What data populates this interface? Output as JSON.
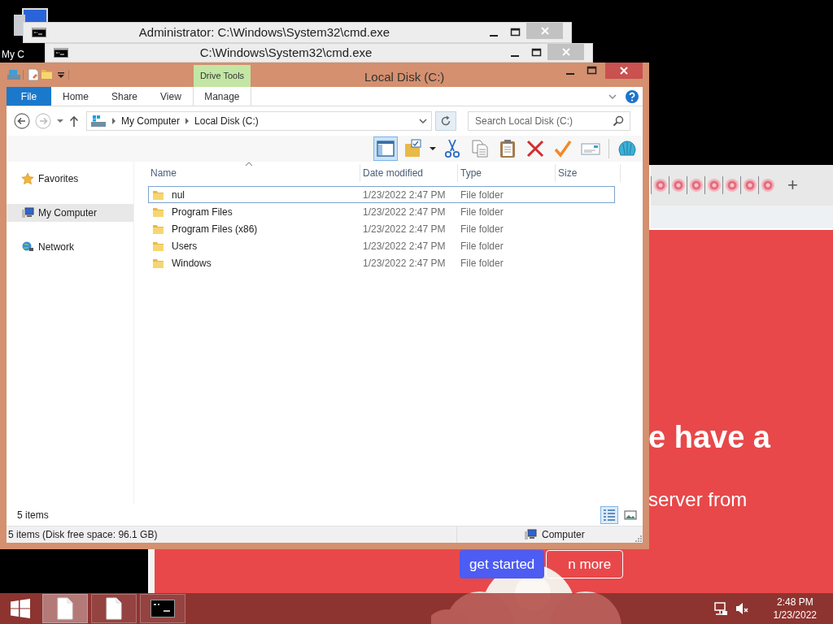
{
  "desktop": {
    "icon_label": "My C"
  },
  "cmd_windows": [
    {
      "title": "Administrator: C:\\Windows\\System32\\cmd.exe"
    },
    {
      "title": "C:\\Windows\\System32\\cmd.exe"
    }
  ],
  "browser": {
    "tabs": [
      {
        "kind": "flower"
      },
      {
        "kind": "flower"
      },
      {
        "kind": "flower"
      },
      {
        "kind": "flower"
      },
      {
        "kind": "flower"
      },
      {
        "kind": "flower"
      },
      {
        "kind": "flower"
      }
    ],
    "new_tab": "+",
    "heading": "e have a",
    "subheading": "server from",
    "buttons": [
      {
        "label": "get started",
        "kind": "primary"
      },
      {
        "label": "n more",
        "kind": "outline"
      }
    ]
  },
  "explorer": {
    "title": "Local Disk (C:)",
    "context_tab": "Drive Tools",
    "ribbon_tabs": [
      {
        "label": "File",
        "kind": "file"
      },
      {
        "label": "Home",
        "kind": "tab"
      },
      {
        "label": "Share",
        "kind": "tab"
      },
      {
        "label": "View",
        "kind": "tab"
      },
      {
        "label": "Manage",
        "kind": "context"
      }
    ],
    "breadcrumb": [
      "My Computer",
      "Local Disk (C:)"
    ],
    "search": {
      "placeholder": "Search Local Disk (C:)"
    },
    "toolbar": [
      {
        "kind": "layout",
        "selected": true
      },
      {
        "kind": "properties",
        "selected": false
      },
      {
        "kind": "cut",
        "selected": false
      },
      {
        "kind": "copy",
        "selected": false
      },
      {
        "kind": "paste",
        "selected": false
      },
      {
        "kind": "delete",
        "selected": false
      },
      {
        "kind": "check",
        "selected": false
      },
      {
        "kind": "rename",
        "selected": false
      },
      {
        "kind": "shell",
        "selected": false
      }
    ],
    "nav": [
      {
        "label": "Favorites",
        "kind": "favorites",
        "selected": false
      },
      {
        "label": "My Computer",
        "kind": "computer",
        "selected": true
      },
      {
        "label": "Network",
        "kind": "network",
        "selected": false
      }
    ],
    "columns": [
      "Name",
      "Date modified",
      "Type",
      "Size"
    ],
    "rows": [
      {
        "name": "nul",
        "date": "1/23/2022 2:47 PM",
        "type": "File folder",
        "selected": true
      },
      {
        "name": "Program Files",
        "date": "1/23/2022 2:47 PM",
        "type": "File folder",
        "selected": false
      },
      {
        "name": "Program Files (x86)",
        "date": "1/23/2022 2:47 PM",
        "type": "File folder",
        "selected": false
      },
      {
        "name": "Users",
        "date": "1/23/2022 2:47 PM",
        "type": "File folder",
        "selected": false
      },
      {
        "name": "Windows",
        "date": "1/23/2022 2:47 PM",
        "type": "File folder",
        "selected": false
      }
    ],
    "item_count": "5 items",
    "view_buttons": [
      {
        "kind": "details",
        "selected": true
      },
      {
        "kind": "thumbnails",
        "selected": false
      }
    ],
    "status": "5 items (Disk free space: 96.1 GB)",
    "status_location": "Computer"
  },
  "taskbar": {
    "buttons": [
      {
        "kind": "document",
        "selected": true
      },
      {
        "kind": "document",
        "selected": false
      },
      {
        "kind": "console",
        "selected": false
      }
    ],
    "time": "2:48 PM",
    "date": "1/23/2022"
  }
}
